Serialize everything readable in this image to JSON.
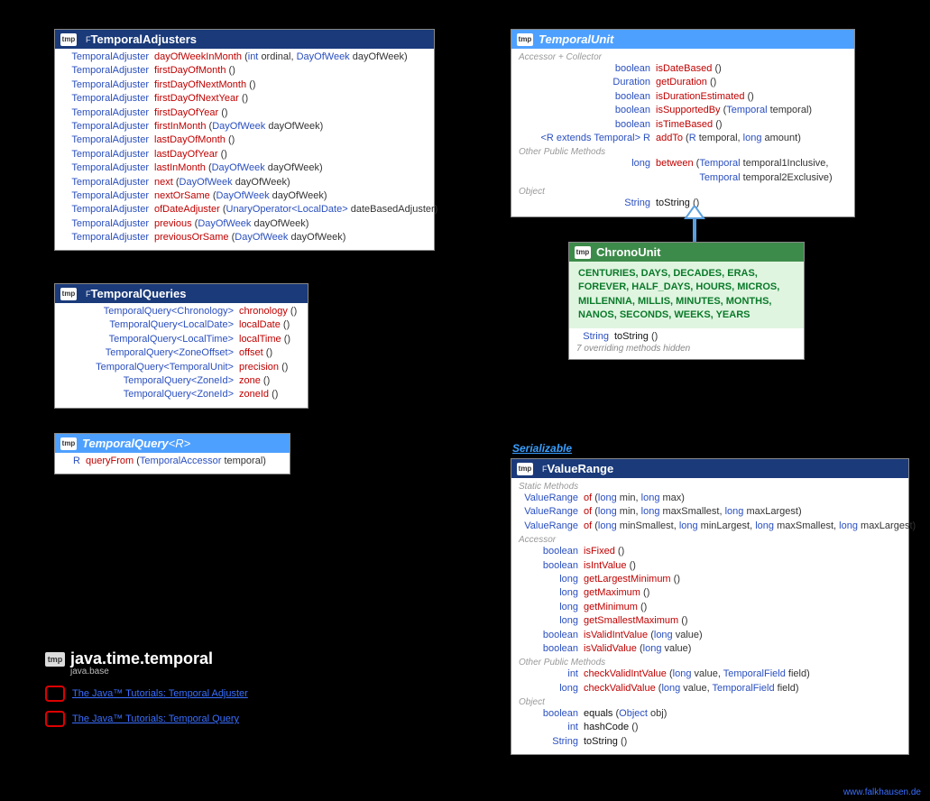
{
  "package": {
    "name": "java.time.temporal",
    "module": "java.base",
    "tutorials": [
      "The Java™ Tutorials: Temporal Adjuster",
      "The Java™ Tutorials: Temporal Query"
    ]
  },
  "footer": "www.falkhausen.de",
  "serializable_label": "Serializable",
  "classes": {
    "temporalAdjusters": {
      "title": "TemporalAdjusters",
      "stereo": "F",
      "retWidth": 96,
      "methods": [
        {
          "ret": "TemporalAdjuster",
          "name": "dayOfWeekInMonth",
          "params": [
            {
              "t": "int",
              "n": "ordinal",
              "k": true
            },
            {
              "t": "DayOfWeek",
              "n": "dayOfWeek"
            }
          ]
        },
        {
          "ret": "TemporalAdjuster",
          "name": "firstDayOfMonth",
          "params": []
        },
        {
          "ret": "TemporalAdjuster",
          "name": "firstDayOfNextMonth",
          "params": []
        },
        {
          "ret": "TemporalAdjuster",
          "name": "firstDayOfNextYear",
          "params": []
        },
        {
          "ret": "TemporalAdjuster",
          "name": "firstDayOfYear",
          "params": []
        },
        {
          "ret": "TemporalAdjuster",
          "name": "firstInMonth",
          "params": [
            {
              "t": "DayOfWeek",
              "n": "dayOfWeek"
            }
          ]
        },
        {
          "ret": "TemporalAdjuster",
          "name": "lastDayOfMonth",
          "params": []
        },
        {
          "ret": "TemporalAdjuster",
          "name": "lastDayOfYear",
          "params": []
        },
        {
          "ret": "TemporalAdjuster",
          "name": "lastInMonth",
          "params": [
            {
              "t": "DayOfWeek",
              "n": "dayOfWeek"
            }
          ]
        },
        {
          "ret": "TemporalAdjuster",
          "name": "next",
          "params": [
            {
              "t": "DayOfWeek",
              "n": "dayOfWeek"
            }
          ]
        },
        {
          "ret": "TemporalAdjuster",
          "name": "nextOrSame",
          "params": [
            {
              "t": "DayOfWeek",
              "n": "dayOfWeek"
            }
          ]
        },
        {
          "ret": "TemporalAdjuster",
          "name": "ofDateAdjuster",
          "params": [
            {
              "t": "UnaryOperator<LocalDate>",
              "n": "dateBasedAdjuster"
            }
          ]
        },
        {
          "ret": "TemporalAdjuster",
          "name": "previous",
          "params": [
            {
              "t": "DayOfWeek",
              "n": "dayOfWeek"
            }
          ]
        },
        {
          "ret": "TemporalAdjuster",
          "name": "previousOrSame",
          "params": [
            {
              "t": "DayOfWeek",
              "n": "dayOfWeek"
            }
          ]
        }
      ]
    },
    "temporalQueries": {
      "title": "TemporalQueries",
      "stereo": "F",
      "retWidth": 190,
      "methods": [
        {
          "ret": "TemporalQuery<Chronology>",
          "name": "chronology",
          "params": []
        },
        {
          "ret": "TemporalQuery<LocalDate>",
          "name": "localDate",
          "params": []
        },
        {
          "ret": "TemporalQuery<LocalTime>",
          "name": "localTime",
          "params": []
        },
        {
          "ret": "TemporalQuery<ZoneOffset>",
          "name": "offset",
          "params": []
        },
        {
          "ret": "TemporalQuery<TemporalUnit>",
          "name": "precision",
          "params": []
        },
        {
          "ret": "TemporalQuery<ZoneId>",
          "name": "zone",
          "params": []
        },
        {
          "ret": "TemporalQuery<ZoneId>",
          "name": "zoneId",
          "params": []
        }
      ]
    },
    "temporalQuery": {
      "title": "TemporalQuery",
      "generic": "<R>",
      "retWidth": 20,
      "methods": [
        {
          "ret": "R",
          "name": "queryFrom",
          "params": [
            {
              "t": "TemporalAccessor",
              "n": "temporal"
            }
          ]
        }
      ]
    },
    "temporalUnit": {
      "title": "TemporalUnit",
      "retWidth": 146,
      "sections": [
        {
          "label": "Accessor + Collector",
          "methods": [
            {
              "ret": "boolean",
              "name": "isDateBased",
              "params": [],
              "retK": true
            },
            {
              "ret": "Duration",
              "name": "getDuration",
              "params": []
            },
            {
              "ret": "boolean",
              "name": "isDurationEstimated",
              "params": [],
              "retK": true
            },
            {
              "ret": "boolean",
              "name": "isSupportedBy",
              "params": [
                {
                  "t": "Temporal",
                  "n": "temporal"
                }
              ],
              "retK": true
            },
            {
              "ret": "boolean",
              "name": "isTimeBased",
              "params": [],
              "retK": true
            },
            {
              "ret": "<R extends Temporal> R",
              "name": "addTo",
              "params": [
                {
                  "t": "R",
                  "n": "temporal"
                },
                {
                  "t": "long",
                  "n": "amount",
                  "k": true
                }
              ],
              "retRaw": true
            }
          ]
        },
        {
          "label": "Other Public Methods",
          "methods": [
            {
              "ret": "long",
              "name": "between",
              "params": [
                {
                  "t": "Temporal",
                  "n": "temporal1Inclusive"
                },
                {
                  "t": "Temporal",
                  "n": "temporal2Exclusive"
                }
              ],
              "retK": true,
              "wrap": true
            }
          ]
        },
        {
          "label": "Object",
          "methods": [
            {
              "ret": "String",
              "name": "toString",
              "params": [],
              "black": true
            }
          ]
        }
      ]
    },
    "chronoUnit": {
      "title": "ChronoUnit",
      "enums": "CENTURIES, DAYS, DECADES, ERAS, FOREVER, HALF_DAYS, HOURS, MICROS, MILLENNIA, MILLIS, MINUTES, MONTHS, NANOS, SECONDS, WEEKS, YEARS",
      "retWidth": 36,
      "methods": [
        {
          "ret": "String",
          "name": "toString",
          "params": [],
          "black": true
        }
      ],
      "note": "7 overriding methods hidden"
    },
    "valueRange": {
      "title": "ValueRange",
      "stereo": "F",
      "retWidth": 66,
      "sections": [
        {
          "label": "Static Methods",
          "methods": [
            {
              "ret": "ValueRange",
              "name": "of",
              "params": [
                {
                  "t": "long",
                  "n": "min",
                  "k": true
                },
                {
                  "t": "long",
                  "n": "max",
                  "k": true
                }
              ]
            },
            {
              "ret": "ValueRange",
              "name": "of",
              "params": [
                {
                  "t": "long",
                  "n": "min",
                  "k": true
                },
                {
                  "t": "long",
                  "n": "maxSmallest",
                  "k": true
                },
                {
                  "t": "long",
                  "n": "maxLargest",
                  "k": true
                }
              ]
            },
            {
              "ret": "ValueRange",
              "name": "of",
              "params": [
                {
                  "t": "long",
                  "n": "minSmallest",
                  "k": true
                },
                {
                  "t": "long",
                  "n": "minLargest",
                  "k": true
                },
                {
                  "t": "long",
                  "n": "maxSmallest",
                  "k": true
                },
                {
                  "t": "long",
                  "n": "maxLargest",
                  "k": true
                }
              ]
            }
          ]
        },
        {
          "label": "Accessor",
          "methods": [
            {
              "ret": "boolean",
              "name": "isFixed",
              "params": [],
              "retK": true
            },
            {
              "ret": "boolean",
              "name": "isIntValue",
              "params": [],
              "retK": true
            },
            {
              "ret": "long",
              "name": "getLargestMinimum",
              "params": [],
              "retK": true
            },
            {
              "ret": "long",
              "name": "getMaximum",
              "params": [],
              "retK": true
            },
            {
              "ret": "long",
              "name": "getMinimum",
              "params": [],
              "retK": true
            },
            {
              "ret": "long",
              "name": "getSmallestMaximum",
              "params": [],
              "retK": true
            },
            {
              "ret": "boolean",
              "name": "isValidIntValue",
              "params": [
                {
                  "t": "long",
                  "n": "value",
                  "k": true
                }
              ],
              "retK": true
            },
            {
              "ret": "boolean",
              "name": "isValidValue",
              "params": [
                {
                  "t": "long",
                  "n": "value",
                  "k": true
                }
              ],
              "retK": true
            }
          ]
        },
        {
          "label": "Other Public Methods",
          "methods": [
            {
              "ret": "int",
              "name": "checkValidIntValue",
              "params": [
                {
                  "t": "long",
                  "n": "value",
                  "k": true
                },
                {
                  "t": "TemporalField",
                  "n": "field"
                }
              ],
              "retK": true
            },
            {
              "ret": "long",
              "name": "checkValidValue",
              "params": [
                {
                  "t": "long",
                  "n": "value",
                  "k": true
                },
                {
                  "t": "TemporalField",
                  "n": "field"
                }
              ],
              "retK": true
            }
          ]
        },
        {
          "label": "Object",
          "methods": [
            {
              "ret": "boolean",
              "name": "equals",
              "params": [
                {
                  "t": "Object",
                  "n": "obj"
                }
              ],
              "retK": true,
              "black": true
            },
            {
              "ret": "int",
              "name": "hashCode",
              "params": [],
              "retK": true,
              "black": true
            },
            {
              "ret": "String",
              "name": "toString",
              "params": [],
              "black": true
            }
          ]
        }
      ]
    }
  }
}
